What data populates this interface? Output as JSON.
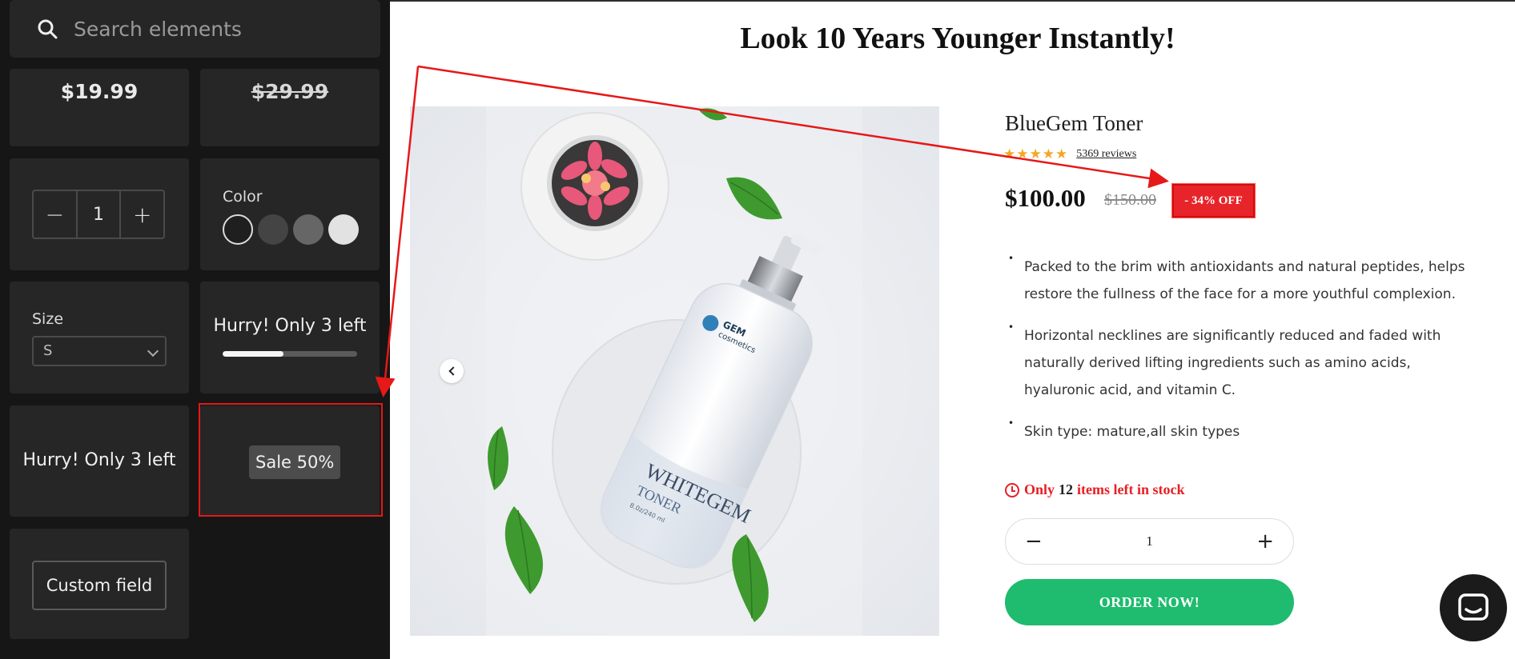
{
  "search": {
    "placeholder": "Search elements"
  },
  "widgets": {
    "price": "$19.99",
    "compare_price": "$29.99",
    "quantity": {
      "minus": "−",
      "value": "1",
      "plus": "+"
    },
    "color": {
      "label": "Color",
      "swatches": [
        "#1f1f1f",
        "#444444",
        "#666666",
        "#e2e2e2"
      ]
    },
    "size": {
      "label": "Size",
      "value": "S"
    },
    "stock_counter": {
      "text": "Hurry! Only 3 left",
      "fill": 0.45
    },
    "stock_text": "Hurry! Only 3 left",
    "sale_badge": "Sale 50%",
    "custom_field": "Custom field"
  },
  "page": {
    "headline": "Look 10 Years Younger Instantly!",
    "product_title": "BlueGem Toner",
    "rating": 5,
    "reviews": "5369 reviews",
    "price": "$100.00",
    "compare_price": "$150.00",
    "discount": "- 34% OFF",
    "bullets": [
      "Packed to the brim with antioxidants and natural peptides, helps restore the fullness of the face for a more youthful complexion.",
      "Horizontal necklines are significantly reduced and faded with naturally derived lifting ingredients such as amino acids, hyaluronic acid, and vitamin C.",
      "Skin type: mature,all skin types"
    ],
    "stock": {
      "prefix": "Only",
      "count": "12",
      "suffix": "items left in stock"
    },
    "quantity": {
      "minus": "−",
      "value": "1",
      "plus": "+"
    },
    "order_button": "ORDER NOW!",
    "bottle": {
      "brand": "GEM",
      "brand_sub": "cosmetics",
      "name": "WHITEGEM",
      "type": "TONER",
      "volume": "8.0z/240 ml"
    }
  },
  "colors": {
    "accent_red": "#e62025",
    "order_green": "#1fbb6f",
    "star": "#f5a623"
  }
}
